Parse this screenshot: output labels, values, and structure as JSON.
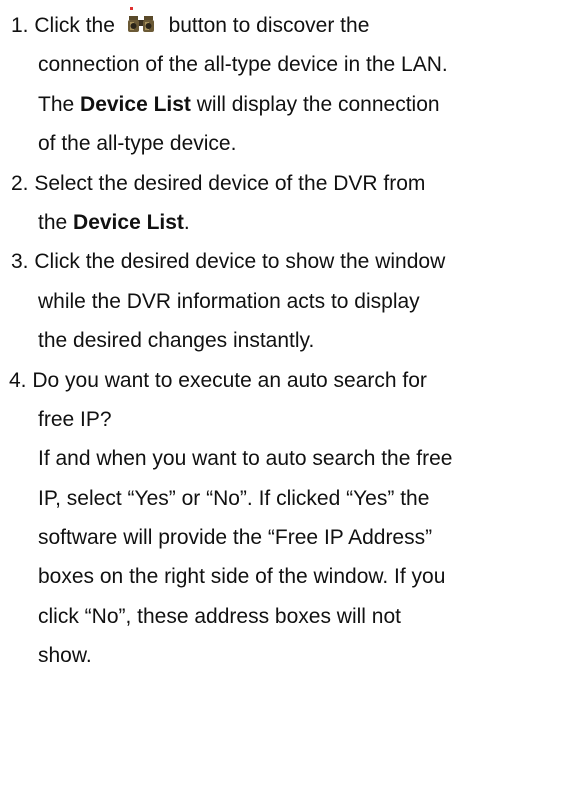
{
  "steps": [
    {
      "number": "1.",
      "line1_pre": "Click the",
      "icon": "binoculars-icon",
      "line1_post": "button to discover the",
      "line2": "connection of the all-type device in the LAN.",
      "line3_pre": "The ",
      "line3_bold": "Device List",
      "line3_post": " will display the connection",
      "line4": "of the all-type device."
    },
    {
      "number": "2.",
      "line1": "Select the desired device of the DVR from",
      "line2_pre": "the ",
      "line2_bold": "Device List",
      "line2_post": "."
    },
    {
      "number": "3.",
      "line1": "Click the desired device to show the window",
      "line2": "while the DVR information acts to display",
      "line3": "the desired changes instantly."
    },
    {
      "number": "4.",
      "line1": "Do you want to execute an auto search for",
      "line2": "free IP?",
      "para": [
        "If and when you want to auto search the free",
        "IP, select “Yes” or “No”. If clicked “Yes” the",
        "software will provide the “Free IP Address”",
        "boxes on the right side of the window. If you",
        "click “No”, these address boxes will not",
        "show."
      ]
    }
  ]
}
